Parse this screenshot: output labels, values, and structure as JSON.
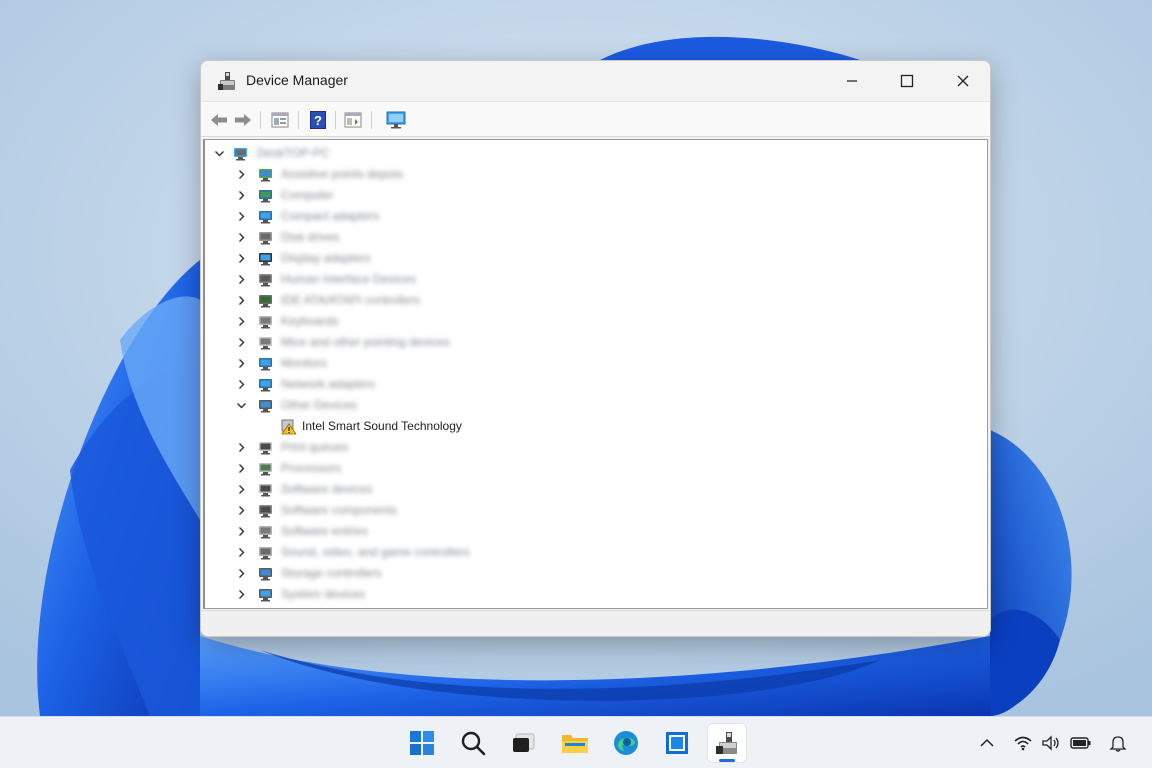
{
  "window": {
    "title": "Device Manager"
  },
  "tree": {
    "root": {
      "label": "DeskTOP-PC"
    },
    "categories": [
      {
        "label": "Assistive points depots",
        "icon": "network-share-icon",
        "expanded": false
      },
      {
        "label": "Computer",
        "icon": "computer-icon",
        "expanded": false
      },
      {
        "label": "Compact adapters",
        "icon": "monitor-icon",
        "expanded": false
      },
      {
        "label": "Disk drives",
        "icon": "disk-drive-icon",
        "expanded": false
      },
      {
        "label": "Display adapters",
        "icon": "display-adapter-icon",
        "expanded": false
      },
      {
        "label": "Human Interface Devices",
        "icon": "hid-icon",
        "expanded": false
      },
      {
        "label": "IDE ATA/ATAPI controllers",
        "icon": "ide-controller-icon",
        "expanded": false
      },
      {
        "label": "Keyboards",
        "icon": "keyboard-icon",
        "expanded": false
      },
      {
        "label": "Mice and other pointing devices",
        "icon": "mouse-icon",
        "expanded": false
      },
      {
        "label": "Monitors",
        "icon": "monitor-icon",
        "expanded": false
      },
      {
        "label": "Network adapters",
        "icon": "network-adapter-icon",
        "expanded": false
      },
      {
        "label": "Other Devices",
        "icon": "other-devices-icon",
        "expanded": true,
        "children": [
          {
            "label": "Intel Smart Sound Technology",
            "icon": "warning-device-icon"
          }
        ]
      },
      {
        "label": "Print queues",
        "icon": "printer-icon",
        "expanded": false
      },
      {
        "label": "Processors",
        "icon": "processor-icon",
        "expanded": false
      },
      {
        "label": "Software devices",
        "icon": "software-device-icon",
        "expanded": false
      },
      {
        "label": "Software components",
        "icon": "software-component-icon",
        "expanded": false
      },
      {
        "label": "Software entries",
        "icon": "software-entry-icon",
        "expanded": false
      },
      {
        "label": "Sound, video, and game controllers",
        "icon": "speaker-icon",
        "expanded": false
      },
      {
        "label": "Storage controllers",
        "icon": "storage-controller-icon",
        "expanded": false
      },
      {
        "label": "System devices",
        "icon": "system-device-icon",
        "expanded": false
      }
    ]
  },
  "colors": {
    "accent": "#1a6fd1",
    "wallpaper_bg": "#bcd3ea",
    "bloom_dark": "#0a3fc0",
    "bloom_light": "#3f8cf2"
  }
}
